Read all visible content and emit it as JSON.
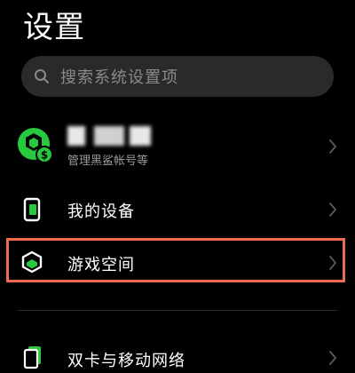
{
  "header": {
    "title": "设置"
  },
  "search": {
    "placeholder": "搜索系统设置项"
  },
  "account": {
    "subtitle": "管理黑鲨帐号等"
  },
  "menu": {
    "my_device": "我的设备",
    "game_space": "游戏空间",
    "sim_network": "双卡与移动网络"
  },
  "colors": {
    "accent_green": "#27c93f",
    "highlight_orange": "#f06b4f"
  },
  "icons": {
    "search": "search-icon",
    "account": "account-avatar-icon",
    "device": "phone-device-icon",
    "game": "game-cube-icon",
    "sim": "sim-card-icon",
    "chevron": "chevron-right-icon"
  }
}
